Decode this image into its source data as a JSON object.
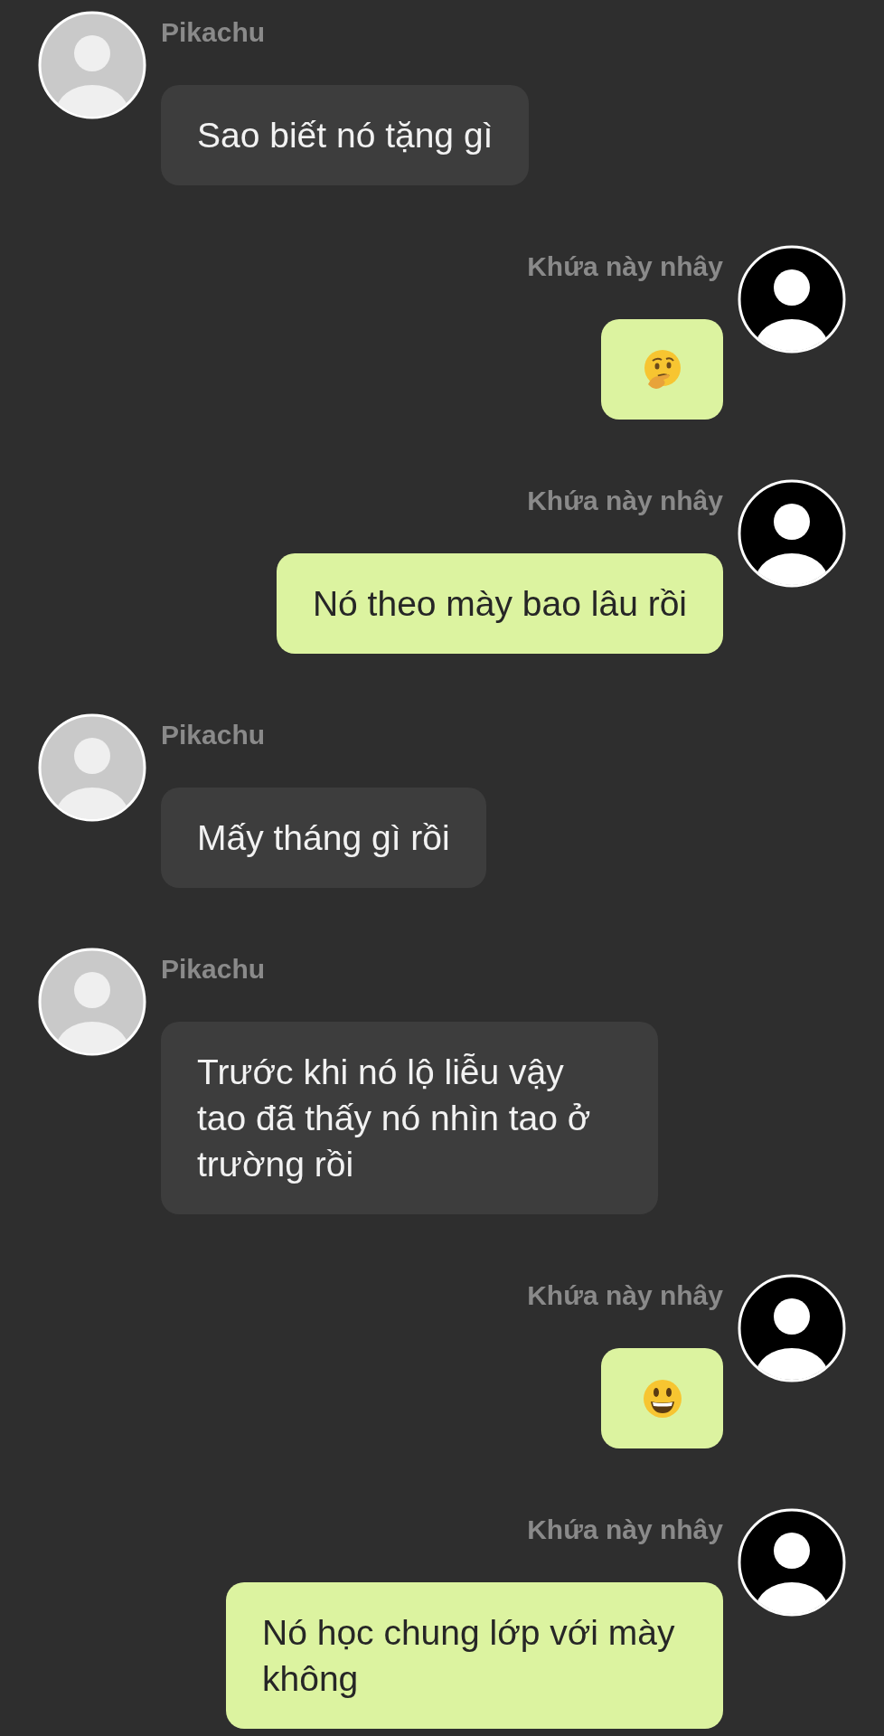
{
  "messages": [
    {
      "kind": "text",
      "outgoing": false,
      "sender": "Pikachu",
      "text": "Sao biết nó tặng gì"
    },
    {
      "kind": "thinking",
      "outgoing": true,
      "sender": "Khứa này nhây"
    },
    {
      "kind": "text",
      "outgoing": true,
      "sender": "Khứa này nhây",
      "text": "Nó theo mày bao lâu rồi"
    },
    {
      "kind": "text",
      "outgoing": false,
      "sender": "Pikachu",
      "text": "Mấy tháng gì rồi"
    },
    {
      "kind": "text",
      "outgoing": false,
      "sender": "Pikachu",
      "text": "Trước khi nó lộ liễu vậy tao đã thấy nó nhìn tao ở trường rồi"
    },
    {
      "kind": "smiley",
      "outgoing": true,
      "sender": "Khứa này nhây"
    },
    {
      "kind": "text",
      "outgoing": true,
      "sender": "Khứa này nhây",
      "text": "Nó học chung lớp với mày không"
    }
  ]
}
